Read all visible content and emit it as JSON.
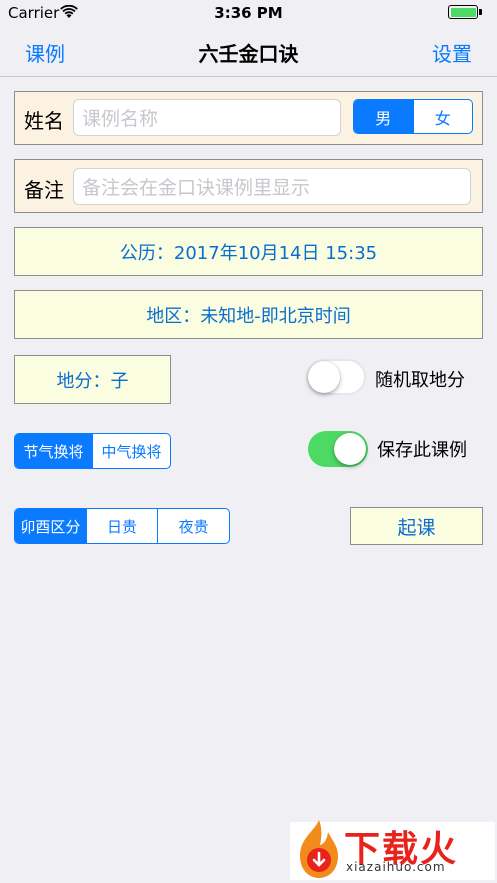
{
  "status_bar": {
    "carrier": "Carrier",
    "time": "3:36 PM"
  },
  "nav": {
    "left": "课例",
    "title": "六壬金口诀",
    "right": "设置"
  },
  "name_row": {
    "label": "姓名",
    "placeholder": "课例名称",
    "gender_options": [
      "男",
      "女"
    ],
    "selected_gender": "男"
  },
  "note_row": {
    "label": "备注",
    "placeholder": "备注会在金口诀课例里显示"
  },
  "date_button": "公历：2017年10月14日 15:35",
  "region_button": "地区：未知地-即北京时间",
  "difen_button": "地分：子",
  "random_switch": {
    "label": "随机取地分",
    "on": false
  },
  "jieqi_segment": {
    "options": [
      "节气换将",
      "中气换将"
    ],
    "selected": "节气换将"
  },
  "save_switch": {
    "label": "保存此课例",
    "on": true
  },
  "guiren_segment": {
    "options": [
      "卯酉区分",
      "日贵",
      "夜贵"
    ],
    "selected": "卯酉区分"
  },
  "start_button": "起课",
  "watermark": {
    "text": "下载火",
    "url": "xiazaihuo.com"
  },
  "colors": {
    "accent": "#0a7aff",
    "switch_on": "#4cd964",
    "beige": "#fbf2e2",
    "yellow": "#fafde0"
  }
}
